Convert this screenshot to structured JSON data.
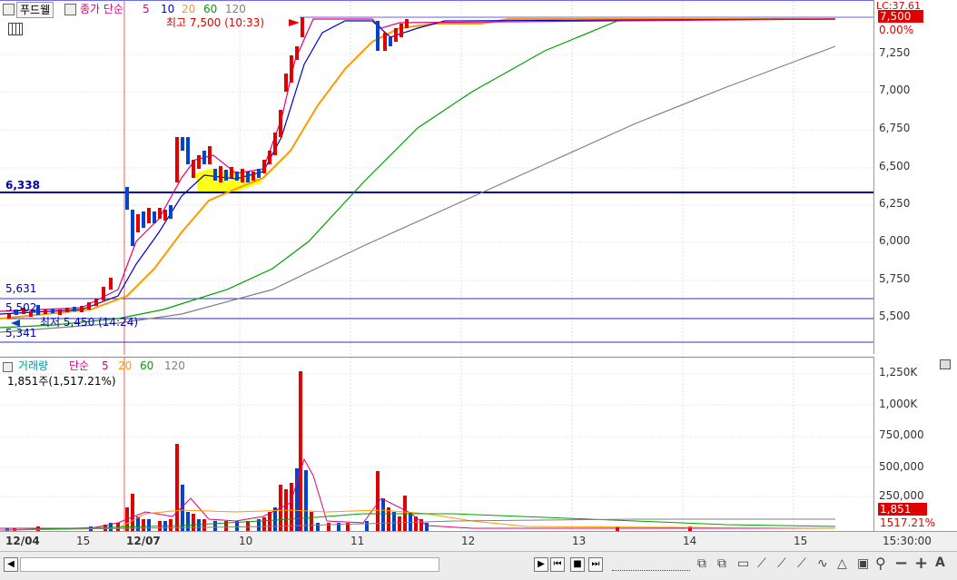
{
  "price_header": {
    "stock_name": "푸드웰",
    "series_label": "종가 단순",
    "ma_periods": [
      "5",
      "10",
      "20",
      "60",
      "120"
    ],
    "ma_colors": [
      "#e0007f",
      "#0000cc",
      "#ff9900",
      "#00a000",
      "#808080"
    ]
  },
  "volume_header": {
    "title": "거래량",
    "series_label": "단순",
    "ma_periods": [
      "5",
      "20",
      "60",
      "120"
    ],
    "info": "1,851주(1,517.21%)"
  },
  "annotations": {
    "high": "최고 7,500 (10:33)",
    "low": "최저 5,450 (14:24)",
    "lines": [
      {
        "label": "6,338",
        "color": "#0000aa"
      },
      {
        "label": "5,631",
        "color": "#0000aa"
      },
      {
        "label": "5,502",
        "color": "#0000aa"
      },
      {
        "label": "5,341",
        "color": "#0000aa"
      }
    ]
  },
  "price_axis": {
    "ticks": [
      "7,250",
      "7,000",
      "6,750",
      "6,500",
      "6,250",
      "6,000",
      "5,750",
      "5,500"
    ],
    "current_price": "7,500",
    "change_pct": "0.00%",
    "top_label": "LC:37.61"
  },
  "volume_axis": {
    "ticks": [
      "1,250K",
      "1,000K",
      "750,000",
      "500,000",
      "250,000"
    ],
    "current_volume": "1,851",
    "volume_pct": "1517.21%"
  },
  "date_axis": {
    "labels": [
      "12/04",
      "15",
      "12/07",
      "10",
      "11",
      "12",
      "13",
      "14",
      "15",
      "15:30:00"
    ]
  },
  "colors": {
    "up": "#e00000",
    "down": "#0044cc",
    "price_badge": "#e00000",
    "highlight": "#ffff00"
  }
}
